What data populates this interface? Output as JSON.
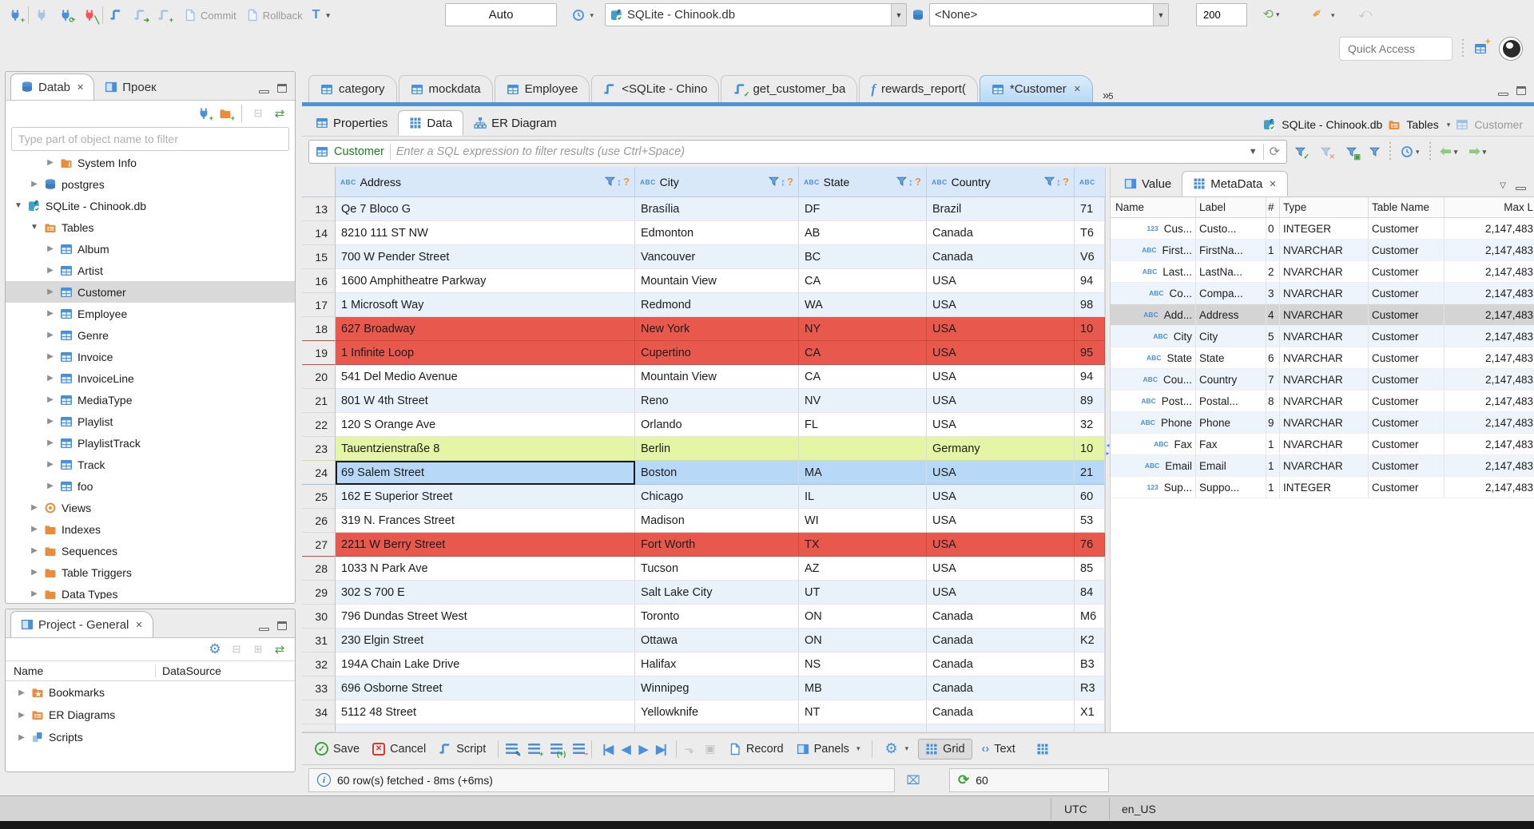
{
  "colors": {
    "accent_blue": "#4f94d6",
    "row_red": "#e8584c",
    "row_green": "#e5f5a6",
    "row_selected": "#b7d9f7",
    "orange": "#ea8c3c"
  },
  "toolbar": {
    "commit": "Commit",
    "rollback": "Rollback",
    "auto": "Auto",
    "db_combo": "SQLite - Chinook.db",
    "schema_combo": "<None>",
    "fetch_size": "200",
    "quick_access_placeholder": "Quick Access"
  },
  "sidebar": {
    "tabs": [
      {
        "label": "Datab"
      },
      {
        "label": "Проек"
      }
    ],
    "filter_placeholder": "Type part of object name to filter",
    "tree": [
      {
        "label": "System Info",
        "indent": 2,
        "expanded": false,
        "icon": "info-folder"
      },
      {
        "label": "postgres",
        "indent": 1,
        "expanded": false,
        "icon": "db"
      },
      {
        "label": "SQLite - Chinook.db",
        "indent": 0,
        "expanded": true,
        "icon": "sqlite"
      },
      {
        "label": "Tables",
        "indent": 1,
        "expanded": true,
        "icon": "folder-table"
      },
      {
        "label": "Album",
        "indent": 2,
        "expanded": false,
        "icon": "table"
      },
      {
        "label": "Artist",
        "indent": 2,
        "expanded": false,
        "icon": "table"
      },
      {
        "label": "Customer",
        "indent": 2,
        "expanded": false,
        "icon": "table",
        "selected": true
      },
      {
        "label": "Employee",
        "indent": 2,
        "expanded": false,
        "icon": "table"
      },
      {
        "label": "Genre",
        "indent": 2,
        "expanded": false,
        "icon": "table"
      },
      {
        "label": "Invoice",
        "indent": 2,
        "expanded": false,
        "icon": "table"
      },
      {
        "label": "InvoiceLine",
        "indent": 2,
        "expanded": false,
        "icon": "table"
      },
      {
        "label": "MediaType",
        "indent": 2,
        "expanded": false,
        "icon": "table"
      },
      {
        "label": "Playlist",
        "indent": 2,
        "expanded": false,
        "icon": "table"
      },
      {
        "label": "PlaylistTrack",
        "indent": 2,
        "expanded": false,
        "icon": "table"
      },
      {
        "label": "Track",
        "indent": 2,
        "expanded": false,
        "icon": "table"
      },
      {
        "label": "foo",
        "indent": 2,
        "expanded": false,
        "icon": "table"
      },
      {
        "label": "Views",
        "indent": 1,
        "expanded": false,
        "icon": "eye"
      },
      {
        "label": "Indexes",
        "indent": 1,
        "expanded": false,
        "icon": "folder"
      },
      {
        "label": "Sequences",
        "indent": 1,
        "expanded": false,
        "icon": "folder"
      },
      {
        "label": "Table Triggers",
        "indent": 1,
        "expanded": false,
        "icon": "folder"
      },
      {
        "label": "Data Types",
        "indent": 1,
        "expanded": false,
        "icon": "folder"
      }
    ]
  },
  "project": {
    "title": "Project - General",
    "columns": [
      "Name",
      "DataSource"
    ],
    "items": [
      {
        "label": "Bookmarks",
        "icon": "folder-star"
      },
      {
        "label": "ER Diagrams",
        "icon": "er"
      },
      {
        "label": "Scripts",
        "icon": "pages"
      }
    ]
  },
  "editor_tabs": [
    {
      "label": "category",
      "icon": "table"
    },
    {
      "label": "mockdata",
      "icon": "table"
    },
    {
      "label": "Employee",
      "icon": "table"
    },
    {
      "label": "<SQLite - Chino",
      "icon": "script"
    },
    {
      "label": "get_customer_ba",
      "icon": "script-check"
    },
    {
      "label": "rewards_report(",
      "icon": "func"
    },
    {
      "label": "*Customer",
      "icon": "table",
      "active": true,
      "close": true
    }
  ],
  "editor_overflow_count": "5",
  "inner_tabs": [
    {
      "label": "Properties"
    },
    {
      "label": "Data"
    },
    {
      "label": "ER Diagram"
    }
  ],
  "breadcrumb": {
    "db": "SQLite - Chinook.db",
    "tables": "Tables",
    "entity": "Customer"
  },
  "filterbar": {
    "entity": "Customer",
    "placeholder": "Enter a SQL expression to filter results (use Ctrl+Space)"
  },
  "grid": {
    "abc_badge": "ABC",
    "columns": [
      "Address",
      "City",
      "State",
      "Country"
    ],
    "rows": [
      {
        "num": 13,
        "address": "Qe 7 Bloco G",
        "city": "Brasília",
        "state": "DF",
        "country": "Brazil",
        "extra": "71"
      },
      {
        "num": 14,
        "address": "8210 111 ST NW",
        "city": "Edmonton",
        "state": "AB",
        "country": "Canada",
        "extra": "T6"
      },
      {
        "num": 15,
        "address": "700 W Pender Street",
        "city": "Vancouver",
        "state": "BC",
        "country": "Canada",
        "extra": "V6"
      },
      {
        "num": 16,
        "address": "1600 Amphitheatre Parkway",
        "city": "Mountain View",
        "state": "CA",
        "country": "USA",
        "extra": "94"
      },
      {
        "num": 17,
        "address": "1 Microsoft Way",
        "city": "Redmond",
        "state": "WA",
        "country": "USA",
        "extra": "98"
      },
      {
        "num": 18,
        "address": "627 Broadway",
        "city": "New York",
        "state": "NY",
        "country": "USA",
        "extra": "10",
        "hl": "red"
      },
      {
        "num": 19,
        "address": "1 Infinite Loop",
        "city": "Cupertino",
        "state": "CA",
        "country": "USA",
        "extra": "95",
        "hl": "red"
      },
      {
        "num": 20,
        "address": "541 Del Medio Avenue",
        "city": "Mountain View",
        "state": "CA",
        "country": "USA",
        "extra": "94"
      },
      {
        "num": 21,
        "address": "801 W 4th Street",
        "city": "Reno",
        "state": "NV",
        "country": "USA",
        "extra": "89"
      },
      {
        "num": 22,
        "address": "120 S Orange Ave",
        "city": "Orlando",
        "state": "FL",
        "country": "USA",
        "extra": "32"
      },
      {
        "num": 23,
        "address": "Tauentzienstraße 8",
        "city": "Berlin",
        "state": "",
        "country": "Germany",
        "extra": "10",
        "hl": "green"
      },
      {
        "num": 24,
        "address": "69 Salem Street",
        "city": "Boston",
        "state": "MA",
        "country": "USA",
        "extra": "21",
        "hl": "sel"
      },
      {
        "num": 25,
        "address": "162 E Superior Street",
        "city": "Chicago",
        "state": "IL",
        "country": "USA",
        "extra": "60"
      },
      {
        "num": 26,
        "address": "319 N. Frances Street",
        "city": "Madison",
        "state": "WI",
        "country": "USA",
        "extra": "53"
      },
      {
        "num": 27,
        "address": "2211 W Berry Street",
        "city": "Fort Worth",
        "state": "TX",
        "country": "USA",
        "extra": "76",
        "hl": "red"
      },
      {
        "num": 28,
        "address": "1033 N Park Ave",
        "city": "Tucson",
        "state": "AZ",
        "country": "USA",
        "extra": "85"
      },
      {
        "num": 29,
        "address": "302 S 700 E",
        "city": "Salt Lake City",
        "state": "UT",
        "country": "USA",
        "extra": "84"
      },
      {
        "num": 30,
        "address": "796 Dundas Street West",
        "city": "Toronto",
        "state": "ON",
        "country": "Canada",
        "extra": "M6"
      },
      {
        "num": 31,
        "address": "230 Elgin Street",
        "city": "Ottawa",
        "state": "ON",
        "country": "Canada",
        "extra": "K2"
      },
      {
        "num": 32,
        "address": "194A Chain Lake Drive",
        "city": "Halifax",
        "state": "NS",
        "country": "Canada",
        "extra": "B3"
      },
      {
        "num": 33,
        "address": "696 Osborne Street",
        "city": "Winnipeg",
        "state": "MB",
        "country": "Canada",
        "extra": "R3"
      },
      {
        "num": 34,
        "address": "5112 48 Street",
        "city": "Yellowknife",
        "state": "NT",
        "country": "Canada",
        "extra": "X1"
      }
    ]
  },
  "meta": {
    "tab_value": "Value",
    "tab_meta": "MetaData",
    "columns": [
      "Name",
      "Label",
      "#",
      "Type",
      "Table Name",
      "Max L"
    ],
    "rows": [
      {
        "badge": "123",
        "name": "Cus...",
        "label": "Custo...",
        "ord": "0",
        "type": "INTEGER",
        "table": "Customer",
        "max": "2,147,483"
      },
      {
        "badge": "ABC",
        "name": "First...",
        "label": "FirstNa...",
        "ord": "1",
        "type": "NVARCHAR",
        "table": "Customer",
        "max": "2,147,483"
      },
      {
        "badge": "ABC",
        "name": "Last...",
        "label": "LastNa...",
        "ord": "2",
        "type": "NVARCHAR",
        "table": "Customer",
        "max": "2,147,483"
      },
      {
        "badge": "ABC",
        "name": "Co...",
        "label": "Compa...",
        "ord": "3",
        "type": "NVARCHAR",
        "table": "Customer",
        "max": "2,147,483"
      },
      {
        "badge": "ABC",
        "name": "Add...",
        "label": "Address",
        "ord": "4",
        "type": "NVARCHAR",
        "table": "Customer",
        "max": "2,147,483",
        "selected": true
      },
      {
        "badge": "ABC",
        "name": "City",
        "label": "City",
        "ord": "5",
        "type": "NVARCHAR",
        "table": "Customer",
        "max": "2,147,483"
      },
      {
        "badge": "ABC",
        "name": "State",
        "label": "State",
        "ord": "6",
        "type": "NVARCHAR",
        "table": "Customer",
        "max": "2,147,483"
      },
      {
        "badge": "ABC",
        "name": "Cou...",
        "label": "Country",
        "ord": "7",
        "type": "NVARCHAR",
        "table": "Customer",
        "max": "2,147,483"
      },
      {
        "badge": "ABC",
        "name": "Post...",
        "label": "Postal...",
        "ord": "8",
        "type": "NVARCHAR",
        "table": "Customer",
        "max": "2,147,483"
      },
      {
        "badge": "ABC",
        "name": "Phone",
        "label": "Phone",
        "ord": "9",
        "type": "NVARCHAR",
        "table": "Customer",
        "max": "2,147,483"
      },
      {
        "badge": "ABC",
        "name": "Fax",
        "label": "Fax",
        "ord": "1",
        "type": "NVARCHAR",
        "table": "Customer",
        "max": "2,147,483"
      },
      {
        "badge": "ABC",
        "name": "Email",
        "label": "Email",
        "ord": "1",
        "type": "NVARCHAR",
        "table": "Customer",
        "max": "2,147,483"
      },
      {
        "badge": "123",
        "name": "Sup...",
        "label": "Suppo...",
        "ord": "1",
        "type": "INTEGER",
        "table": "Customer",
        "max": "2,147,483"
      }
    ]
  },
  "footer": {
    "save": "Save",
    "cancel": "Cancel",
    "script": "Script",
    "record": "Record",
    "panels": "Panels",
    "grid": "Grid",
    "text": "Text"
  },
  "status": {
    "fetched": "60 row(s) fetched - 8ms (+6ms)",
    "refresh_count": "60"
  },
  "osbar": {
    "tz": "UTC",
    "locale": "en_US"
  }
}
